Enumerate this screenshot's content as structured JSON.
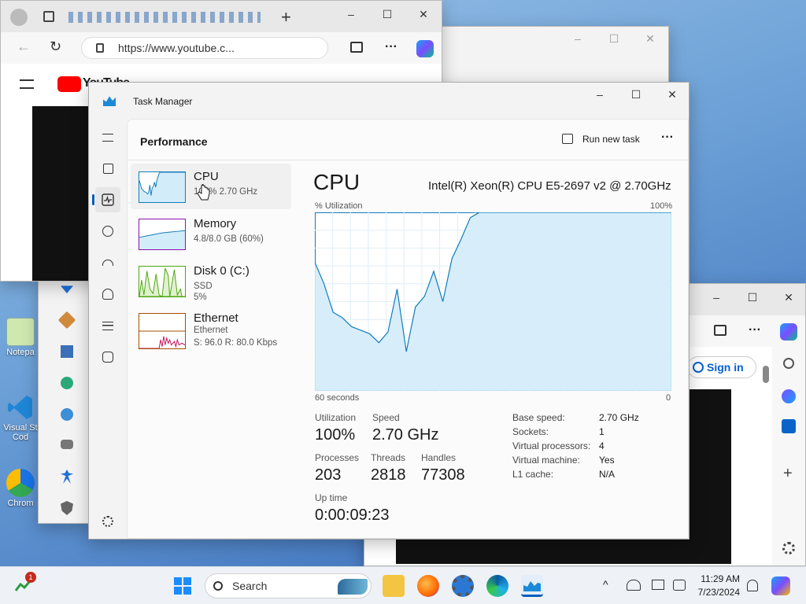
{
  "desktop": {
    "icons": [
      {
        "label": "Notepa"
      },
      {
        "label": "Visual St\nCod"
      },
      {
        "label": "Chrom"
      }
    ]
  },
  "browser_back": {
    "url": "https://www.youtube.c...",
    "youtube_logo_text": "YouTube",
    "new_tab_symbol": "+",
    "menu_dots": "···"
  },
  "browser_right": {
    "sign_in": "Sign in",
    "add_symbol": "+"
  },
  "task_manager": {
    "title": "Task Manager",
    "section": "Performance",
    "run_new_task": "Run new task",
    "more": "···",
    "resources": [
      {
        "name": "CPU",
        "sub1": "100% 2.70 GHz",
        "sub2": ""
      },
      {
        "name": "Memory",
        "sub1": "4.8/8.0 GB (60%)",
        "sub2": ""
      },
      {
        "name": "Disk 0 (C:)",
        "sub1": "SSD",
        "sub2": "5%"
      },
      {
        "name": "Ethernet",
        "sub1": "Ethernet",
        "sub2": "S: 96.0 R: 80.0 Kbps"
      }
    ],
    "detail": {
      "heading": "CPU",
      "processor": "Intel(R) Xeon(R) CPU E5-2697 v2 @ 2.70GHz",
      "graph_label_left": "% Utilization",
      "graph_label_right": "100%",
      "graph_bottom_left": "60 seconds",
      "graph_bottom_right": "0",
      "utilization_series": [
        72,
        60,
        44,
        41,
        36,
        34,
        32,
        27,
        33,
        57,
        22,
        47,
        53,
        67,
        50,
        74,
        85,
        97,
        100,
        100,
        100,
        100,
        100,
        100,
        100,
        100,
        100,
        100,
        100,
        100,
        100,
        100,
        100,
        100,
        100,
        100,
        100,
        100,
        100,
        100
      ],
      "stats": {
        "utilization_label": "Utilization",
        "utilization": "100%",
        "speed_label": "Speed",
        "speed": "2.70 GHz",
        "processes_label": "Processes",
        "processes": "203",
        "threads_label": "Threads",
        "threads": "2818",
        "handles_label": "Handles",
        "handles": "77308",
        "uptime_label": "Up time",
        "uptime": "0:00:09:23"
      },
      "specs": [
        {
          "k": "Base speed:",
          "v": "2.70 GHz"
        },
        {
          "k": "Sockets:",
          "v": "1"
        },
        {
          "k": "Virtual processors:",
          "v": "4"
        },
        {
          "k": "Virtual machine:",
          "v": "Yes"
        },
        {
          "k": "L1 cache:",
          "v": "N/A"
        }
      ]
    }
  },
  "taskbar": {
    "search_placeholder": "Search",
    "badge_count": "1",
    "time": "11:29 AM",
    "date": "7/23/2024"
  },
  "colors": {
    "accent": "#005fb8",
    "cpu_line": "#117dbb",
    "cpu_fill": "#d3ecf9",
    "memory_line": "#8b12ae",
    "disk_line": "#4da60c",
    "ethernet_line": "#a74f01"
  }
}
